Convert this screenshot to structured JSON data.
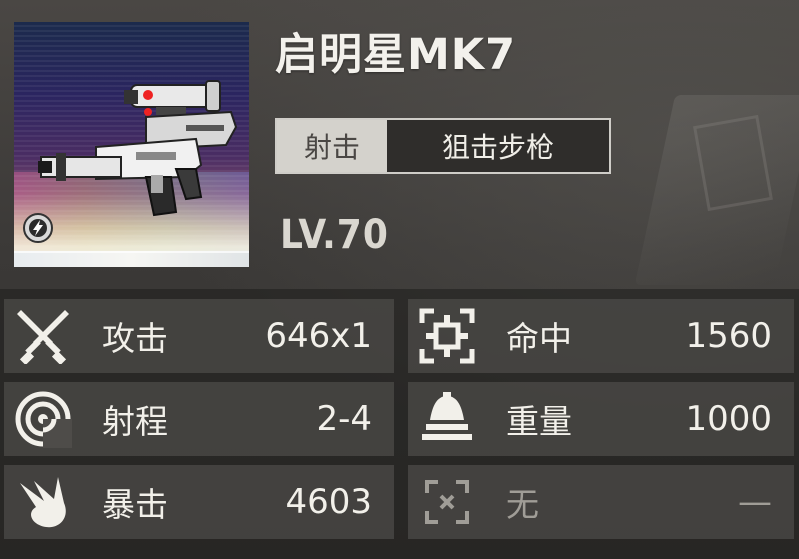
{
  "weapon": {
    "name": "启明星MK7",
    "level_label": "LV.70",
    "tags": [
      "射击",
      "狙击步枪"
    ],
    "element_icon": "lightning-icon"
  },
  "stats": [
    {
      "label": "攻击",
      "value": "646x1",
      "icon": "crossed-swords-icon"
    },
    {
      "label": "命中",
      "value": "1560",
      "icon": "crosshair-icon"
    },
    {
      "label": "射程",
      "value": "2-4",
      "icon": "range-icon"
    },
    {
      "label": "重量",
      "value": "1000",
      "icon": "weight-icon"
    },
    {
      "label": "暴击",
      "value": "4603",
      "icon": "critical-icon"
    },
    {
      "label": "无",
      "value": "—",
      "icon": "empty-slot-icon"
    }
  ],
  "colors": {
    "panel": "#4e4c49",
    "text": "#f2f0ea",
    "dim_text": "#a09d97"
  }
}
